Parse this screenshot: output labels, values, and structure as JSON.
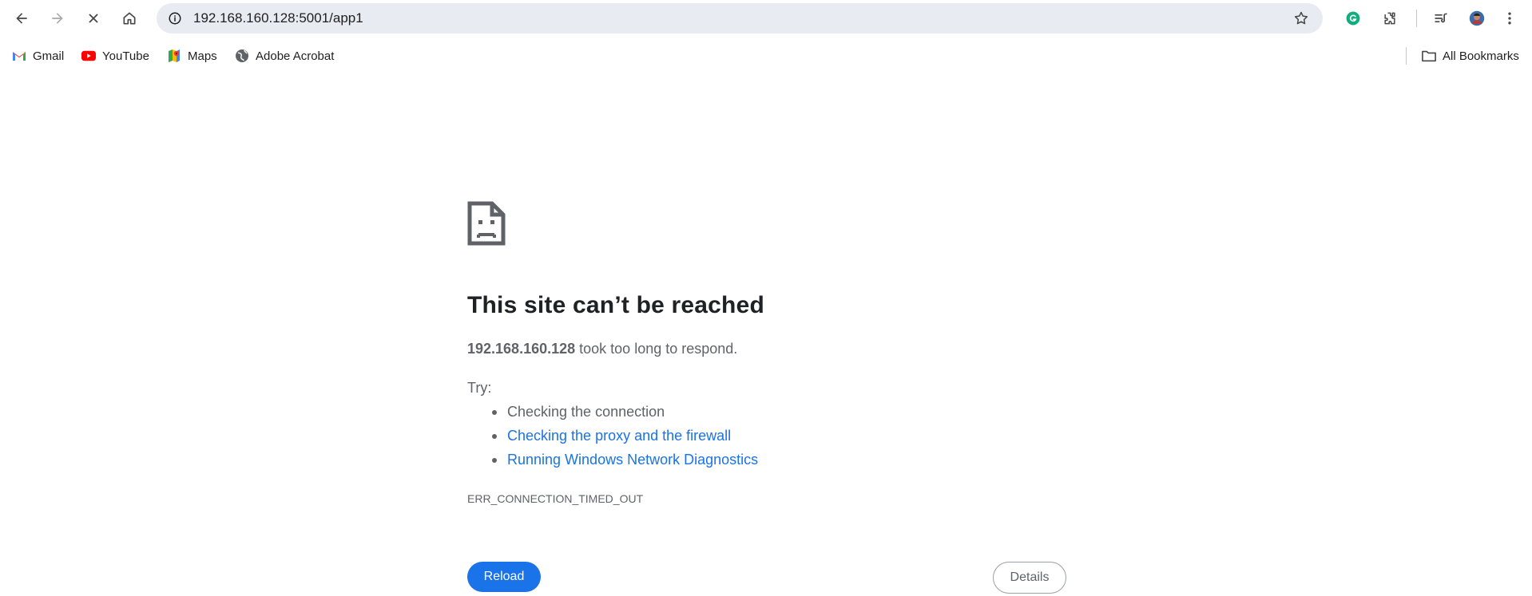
{
  "toolbar": {
    "back_icon": "arrow-left-icon",
    "forward_icon": "arrow-right-icon",
    "stop_icon": "close-icon",
    "home_icon": "home-icon",
    "url": "192.168.160.128:5001/app1",
    "site_info_icon": "info-icon",
    "bookmark_star_icon": "star-icon",
    "grammarly_icon": "grammarly-icon",
    "extensions_icon": "puzzle-icon",
    "reading_list_icon": "playlist-icon",
    "profile_icon": "avatar",
    "menu_icon": "kebab-menu-icon"
  },
  "bookmarks": {
    "items": [
      {
        "label": "Gmail",
        "icon": "gmail-icon"
      },
      {
        "label": "YouTube",
        "icon": "youtube-icon"
      },
      {
        "label": "Maps",
        "icon": "maps-icon"
      },
      {
        "label": "Adobe Acrobat",
        "icon": "globe-icon"
      }
    ],
    "all_bookmarks": {
      "label": "All Bookmarks",
      "icon": "folder-icon"
    }
  },
  "error": {
    "icon": "sad-document-icon",
    "title": "This site can’t be reached",
    "host": "192.168.160.128",
    "message_rest": " took too long to respond.",
    "try_label": "Try:",
    "suggestions": [
      "Checking the connection",
      "Checking the proxy and the firewall",
      "Running Windows Network Diagnostics"
    ],
    "code": "ERR_CONNECTION_TIMED_OUT",
    "reload_label": "Reload",
    "details_label": "Details"
  },
  "colors": {
    "accent": "#1a73e8",
    "omnibox_bg": "#e8ecf2",
    "text_secondary": "#5f6368"
  }
}
